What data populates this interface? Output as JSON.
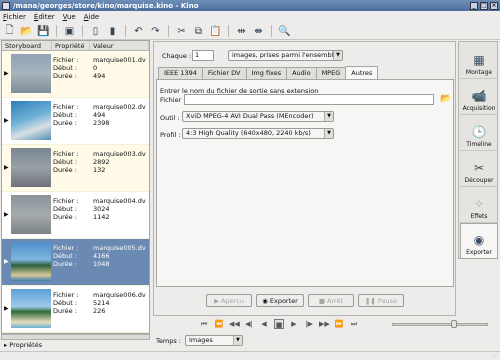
{
  "window": {
    "title": "/mana/georges/store/kino/marquise.kino - Kino"
  },
  "menu": [
    {
      "accel": "F",
      "rest": "ichier"
    },
    {
      "accel": "É",
      "rest": "diter"
    },
    {
      "accel": "V",
      "rest": "ue"
    },
    {
      "accel": "A",
      "rest": "ide"
    }
  ],
  "toolbar": {
    "icons": [
      "new-icon",
      "open-icon",
      "save-icon",
      "export-icon",
      "insert-icon",
      "insert-after-icon",
      "undo-icon",
      "redo-icon",
      "cut-icon",
      "copy-icon",
      "paste-icon",
      "split-icon",
      "join-icon",
      "find-icon"
    ]
  },
  "storyboard": {
    "headers": [
      "Storyboard",
      "Propriété",
      "Valeur"
    ],
    "prop_labels": [
      "Fichier :",
      "Début :",
      "Durée :"
    ],
    "clips": [
      {
        "file": "marquise001.dv",
        "debut": "0",
        "duree": "494",
        "selected": false
      },
      {
        "file": "marquise002.dv",
        "debut": "494",
        "duree": "2398",
        "selected": false
      },
      {
        "file": "marquise003.dv",
        "debut": "2892",
        "duree": "132",
        "selected": false
      },
      {
        "file": "marquise004.dv",
        "debut": "3024",
        "duree": "1142",
        "selected": false
      },
      {
        "file": "marquise005.dv",
        "debut": "4166",
        "duree": "1048",
        "selected": true
      },
      {
        "file": "marquise006.dv",
        "debut": "5214",
        "duree": "226",
        "selected": false
      }
    ],
    "properties_label": "Propriétés"
  },
  "export": {
    "chaque_label": "Chaque :",
    "chaque_value": "1",
    "frames_combo": "images, prises parmi l'ensemble",
    "tabs": [
      "IEEE 1394",
      "Fichier DV",
      "Img fixes",
      "Audio",
      "MPEG",
      "Autres"
    ],
    "active_tab": "Autres",
    "instruction": "Entrer le nom du fichier de sortie sans extension",
    "fichier_label": "Fichier :",
    "fichier_value": "",
    "outil_label": "Outil :",
    "outil_value": "XviD MPEG-4 AVI Dual Pass (MEncoder)",
    "profil_label": "Profil :",
    "profil_value": "4:3 High Quality (640x480, 2240 kb/s)",
    "buttons": {
      "apercu": "Aperçu",
      "exporter": "Exporter",
      "arret": "Arrêt",
      "pause": "Pause"
    }
  },
  "sidebar": {
    "items": [
      {
        "label": "Montage",
        "icon": "montage-icon"
      },
      {
        "label": "Acquisition",
        "icon": "camera-icon"
      },
      {
        "label": "Timeline",
        "icon": "clock-icon"
      },
      {
        "label": "Découper",
        "icon": "scissors-icon"
      },
      {
        "label": "Effets",
        "icon": "sparkle-icon"
      },
      {
        "label": "Exporter",
        "icon": "export-reel-icon"
      }
    ],
    "active": "Exporter"
  },
  "footer": {
    "temps_label": "Temps :",
    "temps_value": "Images"
  },
  "colors": {
    "selection": "#6a8ab3",
    "row_alt": "#fffbe8",
    "titlebar": "#4a6d9c"
  }
}
